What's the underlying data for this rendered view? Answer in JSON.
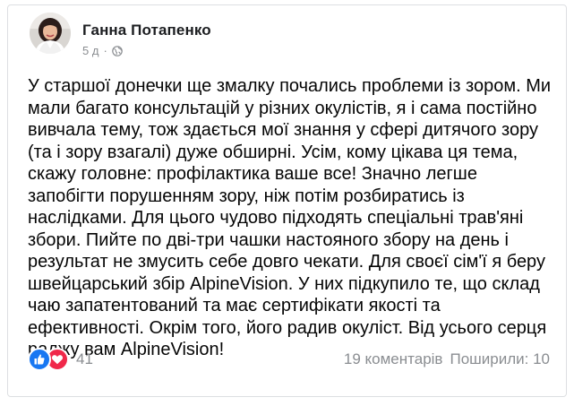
{
  "post": {
    "author": "Ганна Потапенко",
    "time": "5 д",
    "dot": "·",
    "text": "У старшої донечки ще змалку почались проблеми із зором. Ми мали багато консультацій у різних окулістів, я і сама постійно вивчала тему, тож здається мої знання у сфері дитячого зору (та і зору взагалі) дуже обширні. Усім, кому цікава ця тема, скажу головне: профілактика ваше все! Значно легше запобігти порушенням зору, ніж потім розбиратись із наслідками. Для цього чудово підходять спеціальні трав'яні збори. Пийте по дві-три чашки настояного збору на день і результат не змусить себе довго чекати. Для своєї сім'ї я беру швейцарський збір AlpineVision. У них підкупило те, що склад чаю запатентований та має сертифікати якості та ефективності. Окрім того, його радив окуліст. Від усього серця раджу вам AlpineVision!"
  },
  "footer": {
    "reactions_count": "41",
    "comments": "19 коментарів",
    "shares": "Поширили: 10"
  },
  "icons": {
    "like": "like-icon",
    "love": "love-icon",
    "globe": "globe-icon"
  },
  "colors": {
    "like_blue": "#1877f2",
    "love_red": "#f0284a",
    "muted_text": "#8a8d91"
  }
}
